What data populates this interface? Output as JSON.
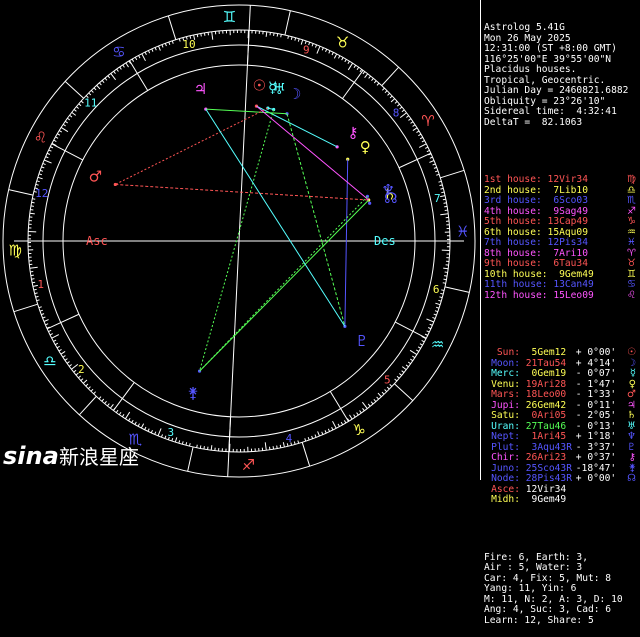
{
  "header": [
    "Astrolog 5.41G",
    "Mon 26 May 2025",
    "12:31:00 (ST +8:00 GMT)",
    "116°25'00\"E 39°55'00\"N",
    "Placidus houses.",
    "Tropical, Geocentric.",
    "Julian Day = 2460821.6882",
    "Obliquity = 23°26'10\"",
    "Sidereal time:  4:32:41",
    "DeltaT =  82.1063"
  ],
  "houses": [
    {
      "label": "1st house:",
      "value": "12Vir34",
      "color": "#ff5555",
      "sym": "♍"
    },
    {
      "label": "2nd house:",
      "value": " 7Lib10",
      "color": "#ffff55",
      "sym": "♎"
    },
    {
      "label": "3rd house:",
      "value": " 6Sco03",
      "color": "#5555ff",
      "sym": "♏"
    },
    {
      "label": "4th house:",
      "value": " 9Sag49",
      "color": "#ff55ff",
      "sym": "♐"
    },
    {
      "label": "5th house:",
      "value": "13Cap49",
      "color": "#ff5555",
      "sym": "♑"
    },
    {
      "label": "6th house:",
      "value": "15Aqu09",
      "color": "#ffff55",
      "sym": "♒"
    },
    {
      "label": "7th house:",
      "value": "12Pis34",
      "color": "#5555ff",
      "sym": "♓"
    },
    {
      "label": "8th house:",
      "value": " 7Ari10",
      "color": "#ff55ff",
      "sym": "♈"
    },
    {
      "label": "9th house:",
      "value": " 6Tau34",
      "color": "#ff5555",
      "sym": "♉"
    },
    {
      "label": "10th house:",
      "value": " 9Gem49",
      "color": "#ffff55",
      "sym": "♊"
    },
    {
      "label": "11th house:",
      "value": "13Can49",
      "color": "#5555ff",
      "sym": "♋"
    },
    {
      "label": "12th house:",
      "value": "15Leo09",
      "color": "#ff55ff",
      "sym": "♌"
    }
  ],
  "planets": [
    {
      "label": "Sun:",
      "value": " 5Gem12",
      "motion": "+ 0°00'",
      "lcolor": "#ff5555",
      "vcolor": "#ffff55",
      "sym": "☉",
      "scolor": "#ff5555"
    },
    {
      "label": "Moon:",
      "value": "21Tau54",
      "motion": "+ 4°14'",
      "lcolor": "#5555ff",
      "vcolor": "#ff5555",
      "sym": "☽",
      "scolor": "#5555ff"
    },
    {
      "label": "Merc:",
      "value": " 0Gem19",
      "motion": "- 0°07'",
      "lcolor": "#55ffff",
      "vcolor": "#ffff55",
      "sym": "☿",
      "scolor": "#55ffff"
    },
    {
      "label": "Venu:",
      "value": "19Ari28",
      "motion": "- 1°47'",
      "lcolor": "#ffff55",
      "vcolor": "#ff5555",
      "sym": "♀",
      "scolor": "#ffff55"
    },
    {
      "label": "Mars:",
      "value": "18Leo00",
      "motion": "- 1°33'",
      "lcolor": "#ff5555",
      "vcolor": "#ff5555",
      "sym": "♂",
      "scolor": "#ff5555"
    },
    {
      "label": "Jupi:",
      "value": "26Gem42",
      "motion": "- 0°11'",
      "lcolor": "#ff55ff",
      "vcolor": "#ffff55",
      "sym": "♃",
      "scolor": "#ff55ff"
    },
    {
      "label": "Satu:",
      "value": " 0Ari05",
      "motion": "- 2°05'",
      "lcolor": "#ffff55",
      "vcolor": "#ff5555",
      "sym": "♄",
      "scolor": "#ffff55"
    },
    {
      "label": "Uran:",
      "value": "27Tau46",
      "motion": "- 0°13'",
      "lcolor": "#55ffff",
      "vcolor": "#55ff55",
      "sym": "♅",
      "scolor": "#55ffff"
    },
    {
      "label": "Nept:",
      "value": " 1Ari45",
      "motion": "+ 1°18'",
      "lcolor": "#5555ff",
      "vcolor": "#ff5555",
      "sym": "♆",
      "scolor": "#5555ff"
    },
    {
      "label": "Plut:",
      "value": " 3Aqu43R",
      "motion": "- 3°37'",
      "lcolor": "#5555ff",
      "vcolor": "#5555ff",
      "sym": "♇",
      "scolor": "#5555ff"
    },
    {
      "label": "Chir:",
      "value": "26Ari23",
      "motion": "+ 0°37'",
      "lcolor": "#ff55ff",
      "vcolor": "#ff5555",
      "sym": "⚷",
      "scolor": "#ff55ff"
    },
    {
      "label": "Juno:",
      "value": "25Sco43R",
      "motion": "-18°47'",
      "lcolor": "#5555ff",
      "vcolor": "#5555ff",
      "sym": "⚵",
      "scolor": "#5555ff"
    },
    {
      "label": "Node:",
      "value": "28Pis43R",
      "motion": "+ 0°00'",
      "lcolor": "#5555ff",
      "vcolor": "#5555ff",
      "sym": "☊",
      "scolor": "#5555ff"
    },
    {
      "label": "Asce:",
      "value": "12Vir34",
      "motion": "",
      "lcolor": "#ff5555",
      "vcolor": "#ffffff",
      "sym": "",
      "scolor": "#ff5555"
    },
    {
      "label": "Midh:",
      "value": " 9Gem49",
      "motion": "",
      "lcolor": "#ffff55",
      "vcolor": "#ffffff",
      "sym": "",
      "scolor": "#ffff55"
    }
  ],
  "summary": [
    "Fire: 6, Earth: 3,",
    "Air : 5, Water: 3",
    "Car: 4, Fix: 5, Mut: 8",
    "Yang: 11, Yin: 6",
    "M: 11, N: 2, A: 3, D: 10",
    "Ang: 4, Suc: 3, Cad: 6",
    "Learn: 12, Share: 5"
  ],
  "wheel": {
    "house_numbers": [
      "1",
      "2",
      "3",
      "4",
      "5",
      "6",
      "7",
      "8",
      "9",
      "10",
      "11",
      "12"
    ],
    "asc_label": "Asc",
    "des_label": "Des",
    "colors": {
      "outer": "#ffffff",
      "red": "#ff5555",
      "yellow": "#ffff55",
      "green": "#55ff55",
      "cyan": "#55ffff",
      "blue": "#5555ff",
      "magenta": "#ff55ff"
    }
  },
  "logo": {
    "brand": "sina",
    "text": "新浪星座"
  }
}
